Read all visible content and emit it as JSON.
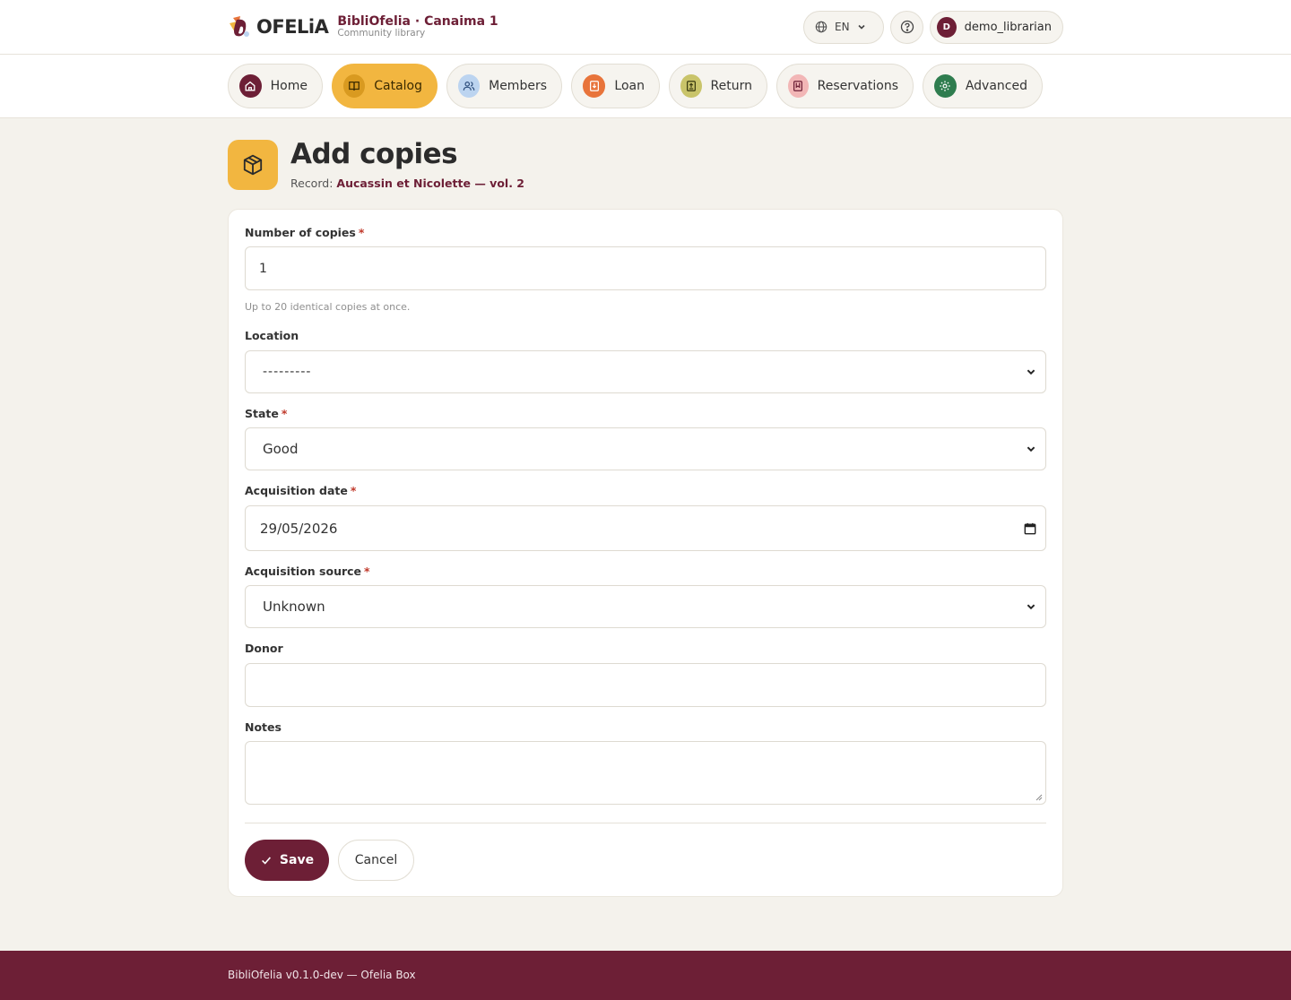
{
  "header": {
    "logo_text": "OFELiA",
    "site_title": "BibliOfelia · Canaima 1",
    "site_subtitle": "Community library",
    "language": "EN",
    "user_initial": "D",
    "username": "demo_librarian"
  },
  "nav": {
    "items": [
      {
        "label": "Home",
        "icon": "home-icon",
        "color": "#6d1f36"
      },
      {
        "label": "Catalog",
        "icon": "book-icon",
        "color": "#d99a20"
      },
      {
        "label": "Members",
        "icon": "users-icon",
        "color": "#bcd4f0"
      },
      {
        "label": "Loan",
        "icon": "loan-icon",
        "color": "#e8743b"
      },
      {
        "label": "Return",
        "icon": "return-icon",
        "color": "#c9c46a"
      },
      {
        "label": "Reservations",
        "icon": "bookmark-icon",
        "color": "#f2b6b6"
      },
      {
        "label": "Advanced",
        "icon": "gear-icon",
        "color": "#2f7d4f"
      }
    ],
    "active": "Catalog"
  },
  "page": {
    "title": "Add copies",
    "record_label": "Record:",
    "record_value": "Aucassin et Nicolette — vol. 2"
  },
  "form": {
    "copies_label": "Number of copies",
    "copies_value": "1",
    "copies_help": "Up to 20 identical copies at once.",
    "location_label": "Location",
    "location_value": "---------",
    "state_label": "State",
    "state_value": "Good",
    "acq_date_label": "Acquisition date",
    "acq_date_value": "29/05/2026",
    "acq_source_label": "Acquisition source",
    "acq_source_value": "Unknown",
    "donor_label": "Donor",
    "donor_value": "",
    "notes_label": "Notes",
    "notes_value": "",
    "required_mark": "*",
    "save_label": "Save",
    "cancel_label": "Cancel"
  },
  "footer": {
    "text": "BibliOfelia v0.1.0-dev — Ofelia Box"
  },
  "colors": {
    "brand": "#6d1f36",
    "accent": "#f2b640",
    "background": "#f4f2ec"
  }
}
